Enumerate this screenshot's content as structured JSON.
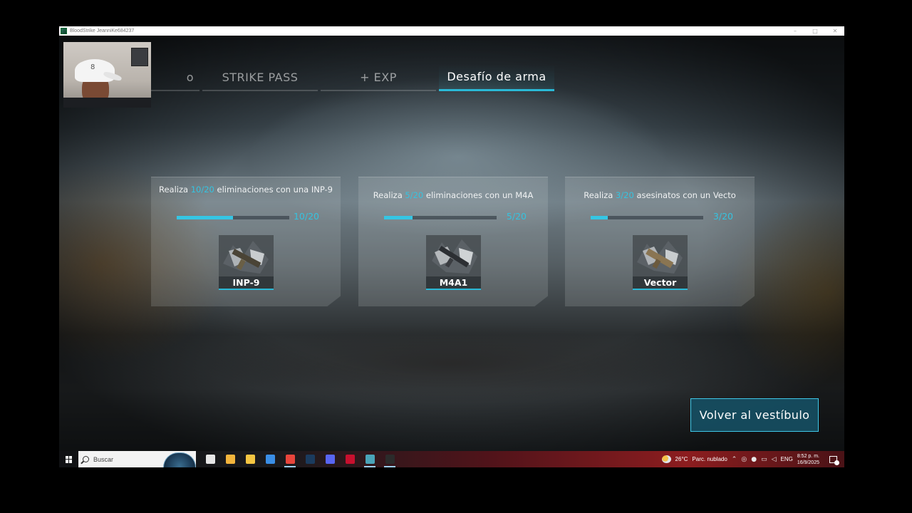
{
  "window": {
    "title": "BloodStrike JeanniKe684237",
    "controls": {
      "minimize": "–",
      "maximize": "□",
      "close": "✕"
    }
  },
  "tabs": [
    {
      "label": "o",
      "active": false
    },
    {
      "label": "STRIKE PASS",
      "active": false
    },
    {
      "label": "+ EXP",
      "active": false
    },
    {
      "label": "Desafío de arma",
      "active": true
    }
  ],
  "challenges": [
    {
      "prefix": "Realiza ",
      "highlight": "10/20",
      "suffix": " eliminaciones con una INP-9",
      "count": "10/20",
      "progress": 0.5,
      "weapon": "INP-9"
    },
    {
      "prefix": "Realiza ",
      "highlight": "5/20",
      "suffix": " eliminaciones con un M4A",
      "count": "5/20",
      "progress": 0.25,
      "weapon": "M4A1"
    },
    {
      "prefix": "Realiza ",
      "highlight": "3/20",
      "suffix": " asesinatos con un Vecto",
      "count": "3/20",
      "progress": 0.15,
      "weapon": "Vector"
    }
  ],
  "return_button": "Volver al vestíbulo",
  "webcam": {
    "cap_logo": "8"
  },
  "taskbar": {
    "search_placeholder": "Buscar",
    "apps": [
      {
        "name": "task-view-icon",
        "color": "#e6e6e6",
        "running": false
      },
      {
        "name": "copilot-icon",
        "color": "#f2b43c",
        "running": false
      },
      {
        "name": "file-explorer-icon",
        "color": "#f4c542",
        "running": false
      },
      {
        "name": "mail-icon",
        "color": "#3a8ee6",
        "running": false
      },
      {
        "name": "chrome-icon",
        "color": "#e8453c",
        "running": true
      },
      {
        "name": "steam-icon",
        "color": "#1b3b5e",
        "running": false
      },
      {
        "name": "discord-icon",
        "color": "#5865f2",
        "running": false
      },
      {
        "name": "app-red-icon",
        "color": "#c8102e",
        "running": false
      },
      {
        "name": "bloodstrike-icon",
        "color": "#4aa3b8",
        "running": true
      },
      {
        "name": "obs-icon",
        "color": "#2b2b2b",
        "running": true
      }
    ],
    "weather_temp": "26°C",
    "weather_desc": "Parc. nublado",
    "language": "ENG",
    "time": "8:52 p. m.",
    "date": "16/9/2025"
  }
}
